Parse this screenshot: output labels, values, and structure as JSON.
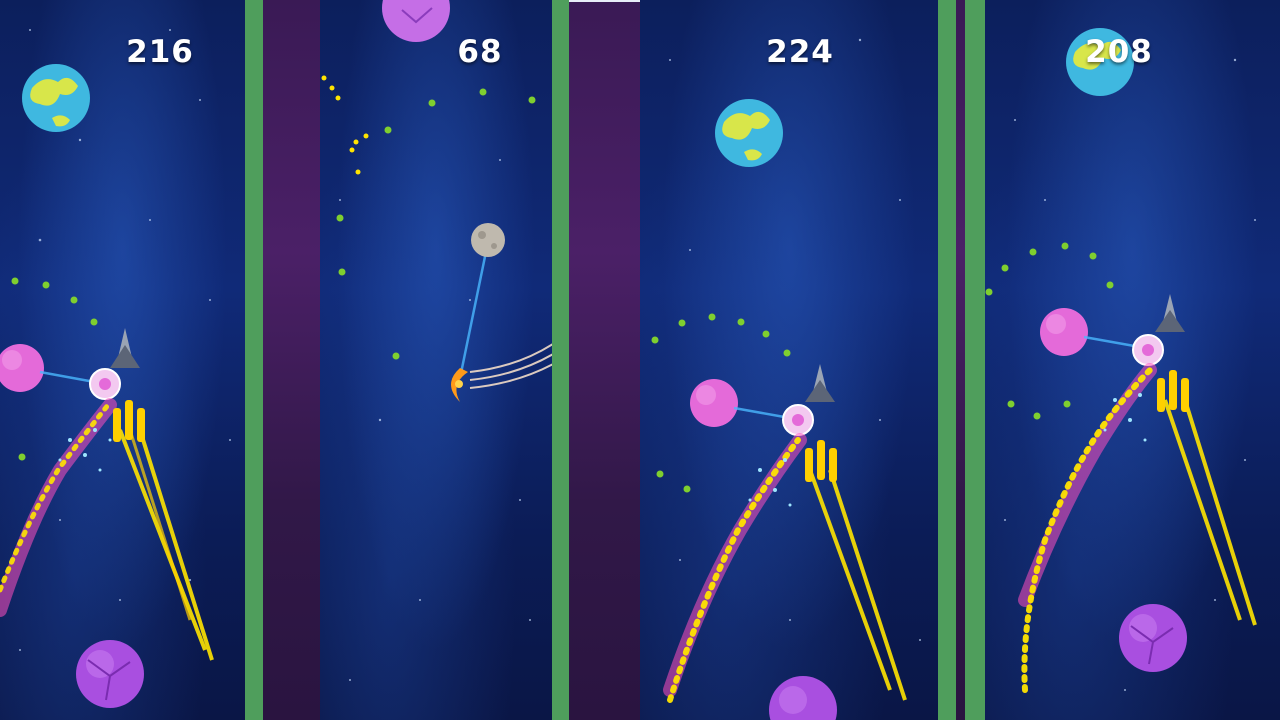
{
  "game": {
    "panels": [
      {
        "score": "216"
      },
      {
        "score": "68"
      },
      {
        "score": "224"
      },
      {
        "score": "208"
      }
    ]
  },
  "colors": {
    "space": "#102a78",
    "divider_green": "#4f9e5c",
    "divider_purple": "#4b2067",
    "dot": "#7fcf2f",
    "trail_yellow": "#ffe400",
    "trail_pink": "#ff4fbf",
    "planet_pink": "#e46ad9",
    "planet_earth": "#3fb8e0"
  },
  "icons": [
    "spaceship-icon",
    "earth-planet-icon",
    "pink-planet-icon",
    "purple-cracked-planet-icon",
    "moon-icon",
    "crescent-ship-icon"
  ]
}
